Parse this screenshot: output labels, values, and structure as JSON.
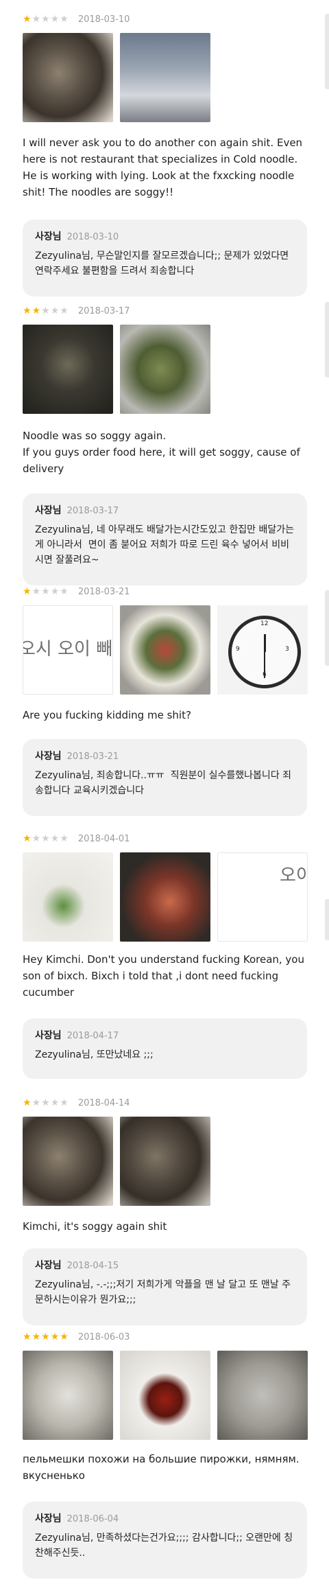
{
  "owner_label": "사장님",
  "reviews": [
    {
      "stars": 1,
      "date": "2018-03-10",
      "photos": [
        "noodle-photo",
        "storefront-photo"
      ],
      "text": "I will never ask you to do another con again shit. Even here is not restaurant that specializes in Cold noodle. He is working with lying. Look at the fxxcking noodle shit! The noodles are soggy!!",
      "reply": {
        "date": "2018-03-10",
        "text": "Zezyulina님, 무슨말인지를 잘모르겠습니다;; 문제가 있었다면 연락주세요 불편함을 드려서 죄송합니다"
      }
    },
    {
      "stars": 2,
      "date": "2018-03-17",
      "photos": [
        "noodle-photo",
        "food-tray-photo"
      ],
      "text": "Noodle was so soggy again.\nIf you guys order food here, it will get soggy, cause of delivery",
      "reply": {
        "date": "2018-03-17",
        "text": "Zezyulina님, 네 아무래도 배달가는시간도있고 한집만 배달가는게 아니라서  면이 좀 붇어요 저희가 따로 드린 육수 넣어서 비비시면 잘풀려요~"
      }
    },
    {
      "stars": 1,
      "date": "2018-03-21",
      "photos": [
        "request-note-photo",
        "bowl-photo",
        "clock-photo"
      ],
      "photo_text": [
        "오시 오이 빼주"
      ],
      "text": "Are you fucking kidding me shit?",
      "reply": {
        "date": "2018-03-21",
        "text": "Zezyulina님, 죄송합니다..ㅠㅠ  직원분이 실수를했나봅니다 죄송합니다 교육시키겠습니다"
      }
    },
    {
      "stars": 1,
      "date": "2018-04-01",
      "photos": [
        "cucumber-photo",
        "hand-photo",
        "request-note-photo"
      ],
      "photo_text": [
        "오이"
      ],
      "text": "Hey Kimchi. Don't you understand fucking Korean, you son of bixch. Bixch i told that ,i dont need fucking cucumber",
      "reply": {
        "date": "2018-04-17",
        "text": "Zezyulina님, 또만났네요 ;;;"
      }
    },
    {
      "stars": 1,
      "date": "2018-04-14",
      "photos": [
        "noodle-photo",
        "noodle-photo"
      ],
      "text": "Kimchi, it's soggy again shit",
      "reply": {
        "date": "2018-04-15",
        "text": "Zezyulina님, -.-;;;저기 저희가게 악플을 맨 날 달고 또 맨날 주문하시는이유가 뭔가요;;;"
      }
    },
    {
      "stars": 5,
      "date": "2018-06-03",
      "photos": [
        "dumpling-bowl-photo",
        "sauce-photo",
        "dumplings-photo"
      ],
      "text": "пельмешки похожи на большие пирожки, нямням. вкусненько",
      "reply": {
        "date": "2018-06-04",
        "text": "Zezyulina님, 만족하셨다는건가요;;;; 감사합니다;; 오랜만에 칭찬해주신듯.."
      }
    }
  ]
}
